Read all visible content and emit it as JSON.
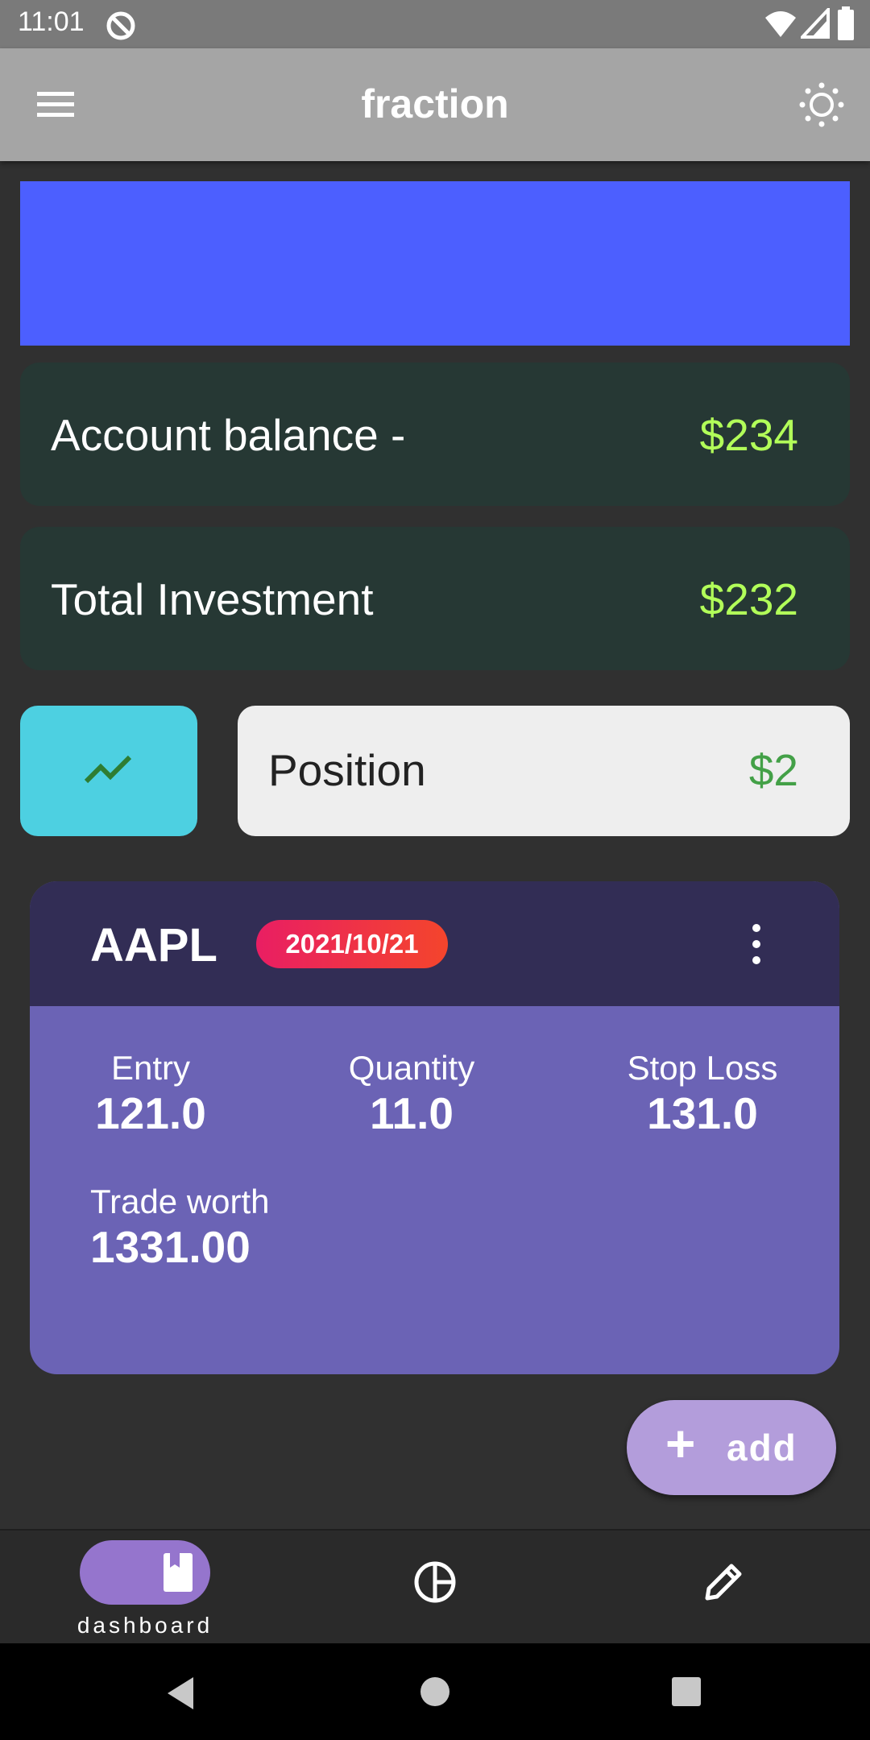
{
  "status_bar": {
    "time": "11:01"
  },
  "app_bar": {
    "title": "fraction"
  },
  "summary": {
    "account_balance": {
      "label": "Account balance  -",
      "value": "$234"
    },
    "total_investment": {
      "label": "Total Investment",
      "value": "$232"
    }
  },
  "position": {
    "label": "Position",
    "value": "$2"
  },
  "trade": {
    "ticker": "AAPL",
    "date": "2021/10/21",
    "entry": {
      "label": "Entry",
      "value": "121.0"
    },
    "quantity": {
      "label": "Quantity",
      "value": "11.0"
    },
    "stop_loss": {
      "label": "Stop Loss",
      "value": "131.0"
    },
    "trade_worth": {
      "label": "Trade worth",
      "value": "1331.00"
    }
  },
  "fab": {
    "icon": "plus-icon",
    "label": "add"
  },
  "bottom_nav": {
    "items": [
      {
        "icon": "bookmark-icon",
        "label": "dashboard",
        "active": true
      },
      {
        "icon": "pie-chart-icon",
        "label": ""
      },
      {
        "icon": "pencil-icon",
        "label": ""
      }
    ]
  },
  "colors": {
    "banner": "#4c5fff",
    "card_dark": "#263834",
    "positive_value": "#b2ff59",
    "position_value": "#43a047",
    "trade_card": "#6b63b5",
    "trade_header": "#322d55",
    "fab": "#b39ddb"
  }
}
